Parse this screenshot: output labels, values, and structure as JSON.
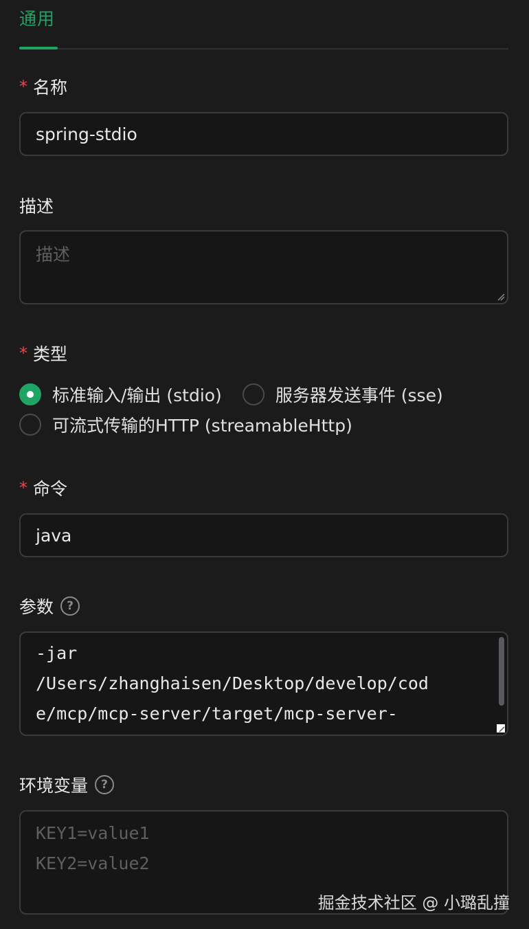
{
  "tabs": {
    "active": "通用"
  },
  "fields": {
    "name": {
      "label": "名称",
      "required_mark": "*",
      "value": "spring-stdio"
    },
    "description": {
      "label": "描述",
      "placeholder": "描述"
    },
    "type": {
      "label": "类型",
      "required_mark": "*",
      "options": [
        {
          "label": "标准输入/输出 (stdio)",
          "checked": true
        },
        {
          "label": "服务器发送事件 (sse)",
          "checked": false
        },
        {
          "label": "可流式传输的HTTP (streamableHttp)",
          "checked": false
        }
      ]
    },
    "command": {
      "label": "命令",
      "required_mark": "*",
      "value": "java"
    },
    "args": {
      "label": "参数",
      "help_icon": "question-circle-icon",
      "lines": [
        "-jar",
        "/Users/zhanghaisen/Desktop/develop/cod",
        "e/mcp/mcp-server/target/mcp-server-"
      ]
    },
    "env": {
      "label": "环境变量",
      "help_icon": "question-circle-icon",
      "placeholder_lines": [
        "KEY1=value1",
        "KEY2=value2"
      ]
    }
  },
  "watermark": "掘金技术社区 @ 小璐乱撞",
  "colors": {
    "accent": "#1fa463",
    "required": "#e5484d",
    "background": "#1b1b1c"
  }
}
